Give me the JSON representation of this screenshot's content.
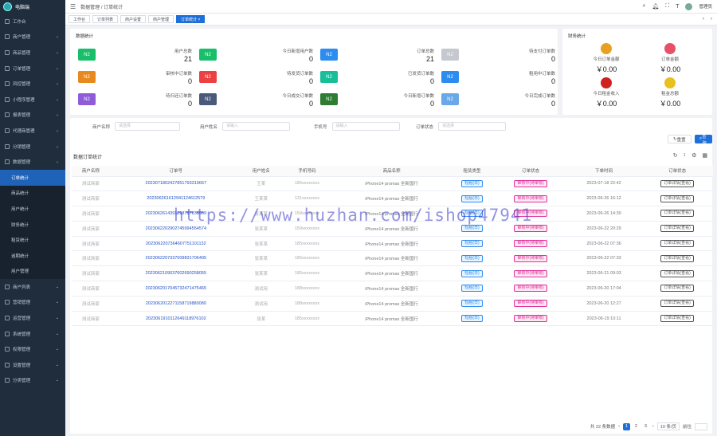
{
  "app": {
    "logo_text": "电脑端"
  },
  "sidebar": {
    "items": [
      {
        "label": "工作台",
        "sub": false,
        "active": false,
        "chev": false
      },
      {
        "label": "商户管理",
        "sub": false,
        "active": false,
        "chev": true
      },
      {
        "label": "商品管理",
        "sub": false,
        "active": false,
        "chev": true
      },
      {
        "label": "订单管理",
        "sub": false,
        "active": false,
        "chev": true
      },
      {
        "label": "风控管理",
        "sub": false,
        "active": false,
        "chev": true
      },
      {
        "label": "小程序管理",
        "sub": false,
        "active": false,
        "chev": true
      },
      {
        "label": "报表管理",
        "sub": false,
        "active": false,
        "chev": true
      },
      {
        "label": "代理商管理",
        "sub": false,
        "active": false,
        "chev": true
      },
      {
        "label": "分销管理",
        "sub": false,
        "active": false,
        "chev": true
      },
      {
        "label": "数据管理",
        "sub": false,
        "active": false,
        "chev": true
      },
      {
        "label": "订单统计",
        "sub": true,
        "active": true,
        "chev": false
      },
      {
        "label": "商品统计",
        "sub": true,
        "active": false,
        "chev": false
      },
      {
        "label": "用户统计",
        "sub": true,
        "active": false,
        "chev": false
      },
      {
        "label": "财务统计",
        "sub": true,
        "active": false,
        "chev": false
      },
      {
        "label": "租赁统计",
        "sub": true,
        "active": false,
        "chev": false
      },
      {
        "label": "逾期统计",
        "sub": true,
        "active": false,
        "chev": false
      },
      {
        "label": "用户管理",
        "sub": true,
        "active": false,
        "chev": false
      },
      {
        "label": "商户列表",
        "sub": false,
        "active": false,
        "chev": true
      },
      {
        "label": "营销管理",
        "sub": false,
        "active": false,
        "chev": true
      },
      {
        "label": "运营管理",
        "sub": false,
        "active": false,
        "chev": true
      },
      {
        "label": "系统管理",
        "sub": false,
        "active": false,
        "chev": true
      },
      {
        "label": "权限管理",
        "sub": false,
        "active": false,
        "chev": true
      },
      {
        "label": "设置管理",
        "sub": false,
        "active": false,
        "chev": true
      },
      {
        "label": "分类管理",
        "sub": false,
        "active": false,
        "chev": true
      }
    ]
  },
  "topbar": {
    "breadcrumb": "数据管理  /  订单统计",
    "user": "管理员"
  },
  "tabs": [
    {
      "label": "工作台",
      "active": false
    },
    {
      "label": "订单列表",
      "active": false
    },
    {
      "label": "商户设置",
      "active": false
    },
    {
      "label": "商户管理",
      "active": false
    },
    {
      "label": "订单统计 ×",
      "active": true
    }
  ],
  "stats": {
    "title": "数据统计",
    "items": [
      {
        "icon": "N2",
        "color": "#19be6b",
        "label": "用户总数",
        "value": "21"
      },
      {
        "icon": "N2",
        "color": "#19be6b",
        "label": "今日新增用户数",
        "value": "0"
      },
      {
        "icon": "N2",
        "color": "#2d8cf0",
        "label": "订单总数",
        "value": "21"
      },
      {
        "icon": "N2",
        "color": "#c5c8ce",
        "label": "待支付订单数",
        "value": "0"
      },
      {
        "icon": "N2",
        "color": "#e8891f",
        "label": "审核中订单数",
        "value": "0"
      },
      {
        "icon": "N2",
        "color": "#ed4040",
        "label": "待发货订单数",
        "value": "0"
      },
      {
        "icon": "N2",
        "color": "#19be9b",
        "label": "已发货订单数",
        "value": "0"
      },
      {
        "icon": "N2",
        "color": "#2d8cf0",
        "label": "租用中订单数",
        "value": "0"
      },
      {
        "icon": "N2",
        "color": "#8e5cd8",
        "label": "待归还订单数",
        "value": "0"
      },
      {
        "icon": "N2",
        "color": "#4a5a7a",
        "label": "今日成交订单数",
        "value": "0"
      },
      {
        "icon": "N2",
        "color": "#2e7d32",
        "label": "今日新增订单数",
        "value": "0"
      },
      {
        "icon": "N2",
        "color": "#6aa8e8",
        "label": "今日完成订单数",
        "value": "0"
      }
    ]
  },
  "finance": {
    "title": "财务统计",
    "items": [
      {
        "label": "今日订单金额",
        "value": "￥0.00",
        "color": "#e8a020"
      },
      {
        "label": "订单金额",
        "value": "￥0.00",
        "color": "#e8506a"
      },
      {
        "label": "今日租金收入",
        "value": "￥0.00",
        "color": "#d02020"
      },
      {
        "label": "租金总额",
        "value": "￥0.00",
        "color": "#e8c020"
      }
    ]
  },
  "filters": {
    "shop_label": "商户名称",
    "shop_ph": "请选择",
    "name_label": "用户姓名",
    "name_ph": "请输入",
    "phone_label": "手机号",
    "phone_ph": "请输入",
    "status_label": "订单状态",
    "status_ph": "请选择",
    "reset": "重置",
    "search": "查询"
  },
  "table": {
    "title": "数据订单统计",
    "headers": [
      "商户名称",
      "订单号",
      "用户姓名",
      "手机号码",
      "商品名称",
      "租赁类型",
      "订单状态",
      "下单时间",
      "订单状态"
    ],
    "rows": [
      {
        "shop": "测试商家",
        "order": "2023071802427851793319667",
        "name": "王某",
        "phone": "185xxxxxxxx",
        "goods": "iPhone14 promax 全新国行",
        "type": "短租(日)",
        "status": "审核中(待审核)",
        "time": "2023-07-18 22:42",
        "act": "订单详情(查看)"
      },
      {
        "shop": "测试商家",
        "order": "202306261612941124612579",
        "name": "王某某",
        "phone": "131xxxxxxxx",
        "goods": "iPhone14 promax 全新国行",
        "type": "短租(日)",
        "status": "审核中(待审核)",
        "time": "2023-06-26 16:12",
        "act": "订单详情(查看)"
      },
      {
        "shop": "测试商家",
        "order": "2023062614391298787838969",
        "name": "张某某",
        "phone": "159xxxxxxxx",
        "goods": "iPhone14 promax 全新国行",
        "type": "短租(日)",
        "status": "审核中(待审核)",
        "time": "2023-06-26 14:39",
        "act": "订单详情(查看)"
      },
      {
        "shop": "测试商家",
        "order": "2023062202902745994554574",
        "name": "张某某",
        "phone": "159xxxxxxxx",
        "goods": "iPhone14 promax 全新国行",
        "type": "短租(日)",
        "status": "审核中(待审核)",
        "time": "2023-06-22 20:29",
        "act": "订单详情(查看)"
      },
      {
        "shop": "测试商家",
        "order": "2023062207364607751101132",
        "name": "张某某",
        "phone": "185xxxxxxxx",
        "goods": "iPhone14 promax 全新国行",
        "type": "短租(日)",
        "status": "审核中(待审核)",
        "time": "2023-06-22 07:36",
        "act": "订单详情(查看)"
      },
      {
        "shop": "测试商家",
        "order": "2023062207337009831706405",
        "name": "张某某",
        "phone": "185xxxxxxxx",
        "goods": "iPhone14 promax 全新国行",
        "type": "短租(日)",
        "status": "审核中(待审核)",
        "time": "2023-06-22 07:33",
        "act": "订单详情(查看)"
      },
      {
        "shop": "测试商家",
        "order": "2023062109037602690258055",
        "name": "张某某",
        "phone": "185xxxxxxxx",
        "goods": "iPhone14 promax 全新国行",
        "type": "短租(日)",
        "status": "审核中(待审核)",
        "time": "2023-06-21 09:03",
        "act": "订单详情(查看)"
      },
      {
        "shop": "测试商家",
        "order": "2023062017045732471475465",
        "name": "测试用",
        "phone": "188xxxxxxxx",
        "goods": "iPhone14 promax 全新国行",
        "type": "短租(日)",
        "status": "审核中(待审核)",
        "time": "2023-06-20 17:04",
        "act": "订单详情(查看)"
      },
      {
        "shop": "测试商家",
        "order": "2023062012271158719880080",
        "name": "测试用",
        "phone": "188xxxxxxxx",
        "goods": "iPhone14 promax 全新国行",
        "type": "短租(日)",
        "status": "审核中(待审核)",
        "time": "2023-06-20 12:27",
        "act": "订单详情(查看)"
      },
      {
        "shop": "测试商家",
        "order": "2023061910112649118976102",
        "name": "张某",
        "phone": "185xxxxxxxx",
        "goods": "iPhone14 promax 全新国行",
        "type": "短租(日)",
        "status": "审核中(待审核)",
        "time": "2023-06-19 10:11",
        "act": "订单详情(查看)"
      }
    ]
  },
  "pagination": {
    "total": "共 22 条数据",
    "pages": [
      "1",
      "2",
      "3"
    ],
    "size": "10 条/页",
    "goto": "前往"
  },
  "watermark": "https://www.huzhan.com/ishop47941"
}
